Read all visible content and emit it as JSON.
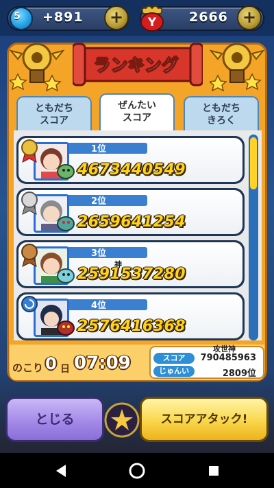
{
  "topbar": {
    "watch_level": "5",
    "gems": "+891",
    "coins": "2666",
    "plus_glyph": "+",
    "coin_icon": "y-money-icon"
  },
  "title": "ランキング",
  "tabs": [
    {
      "line1": "ともだち",
      "line2": "スコア"
    },
    {
      "line1": "ぜんたい",
      "line2": "スコア",
      "active": true
    },
    {
      "line1": "ともだち",
      "line2": "きろく"
    }
  ],
  "rows": [
    {
      "rank": "1位",
      "name": "",
      "score": "4673440549",
      "medal": "gold"
    },
    {
      "rank": "2位",
      "name": "",
      "score": "2659641254",
      "medal": "silver"
    },
    {
      "rank": "3位",
      "name": "神",
      "score": "2591537280",
      "medal": "bronze"
    },
    {
      "rank": "4位",
      "name": "",
      "score": "2576416368",
      "medal": "blue"
    }
  ],
  "footer": {
    "remain_prefix": "のこり",
    "remain_days": "0",
    "day_unit": "日",
    "remain_time": "07:09",
    "my_name": "攻世神",
    "score_label": "スコア",
    "score_value": "790485963",
    "rank_label": "じゅんい",
    "rank_value": "2809位"
  },
  "buttons": {
    "close": "とじる",
    "attack": "スコアアタック!"
  },
  "colors": {
    "accent": "#f4a427",
    "score_text": "#ffd31a",
    "rank_bar": "#3b7fd1"
  }
}
